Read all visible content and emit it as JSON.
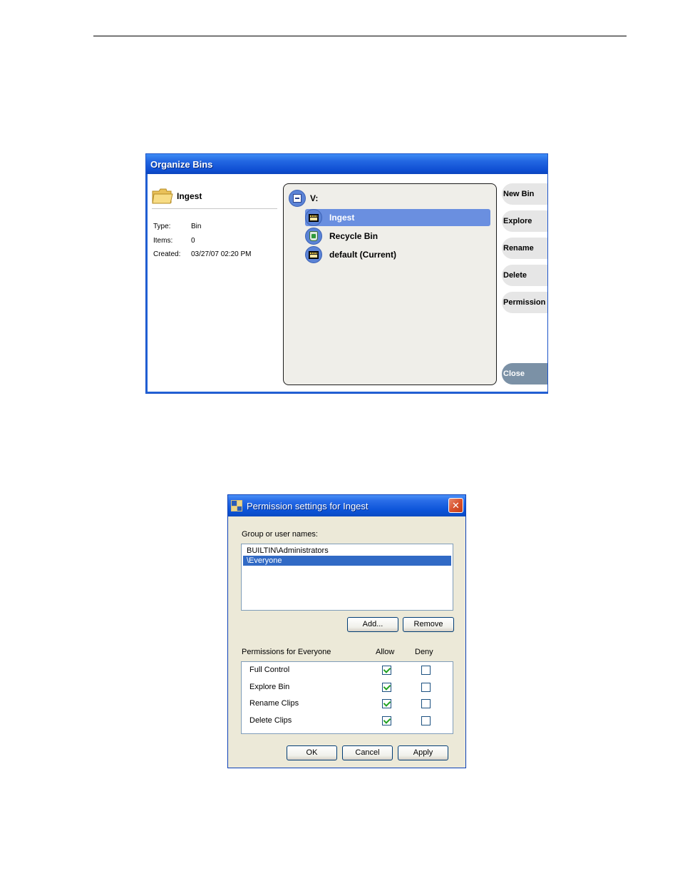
{
  "organize_bins": {
    "title": "Organize Bins",
    "selected_name": "Ingest",
    "properties": [
      {
        "label": "Type:",
        "value": "Bin"
      },
      {
        "label": "Items:",
        "value": "0"
      },
      {
        "label": "Created:",
        "value": "03/27/07 02:20 PM"
      }
    ],
    "tree": {
      "root_label": "V:",
      "items": [
        {
          "label": "Ingest",
          "icon": "clip-bin-icon",
          "selected": true
        },
        {
          "label": "Recycle Bin",
          "icon": "recycle-bin-icon",
          "selected": false
        },
        {
          "label": "default (Current)",
          "icon": "clip-bin-icon",
          "selected": false
        }
      ]
    },
    "buttons": {
      "new_bin": "New Bin",
      "explore": "Explore",
      "rename": "Rename",
      "delete": "Delete",
      "permission": "Permission",
      "close": "Close"
    }
  },
  "permission_dialog": {
    "title": "Permission settings for Ingest",
    "close_glyph": "✕",
    "group_label": "Group or user names:",
    "users": [
      {
        "name": "BUILTIN\\Administrators",
        "selected": false
      },
      {
        "name": "\\Everyone",
        "selected": true
      }
    ],
    "add_label": "Add...",
    "remove_label": "Remove",
    "permissions_label": "Permissions for Everyone",
    "allow_label": "Allow",
    "deny_label": "Deny",
    "permissions": [
      {
        "name": "Full Control",
        "allow": true,
        "deny": false
      },
      {
        "name": "Explore Bin",
        "allow": true,
        "deny": false
      },
      {
        "name": "Rename Clips",
        "allow": true,
        "deny": false
      },
      {
        "name": "Delete Clips",
        "allow": true,
        "deny": false
      }
    ],
    "ok_label": "OK",
    "cancel_label": "Cancel",
    "apply_label": "Apply"
  },
  "colors": {
    "xp_title_blue": "#0c54d9",
    "selection_blue": "#316ac5",
    "tree_selection": "#6a8fe0",
    "close_button": "#7b91a6"
  }
}
